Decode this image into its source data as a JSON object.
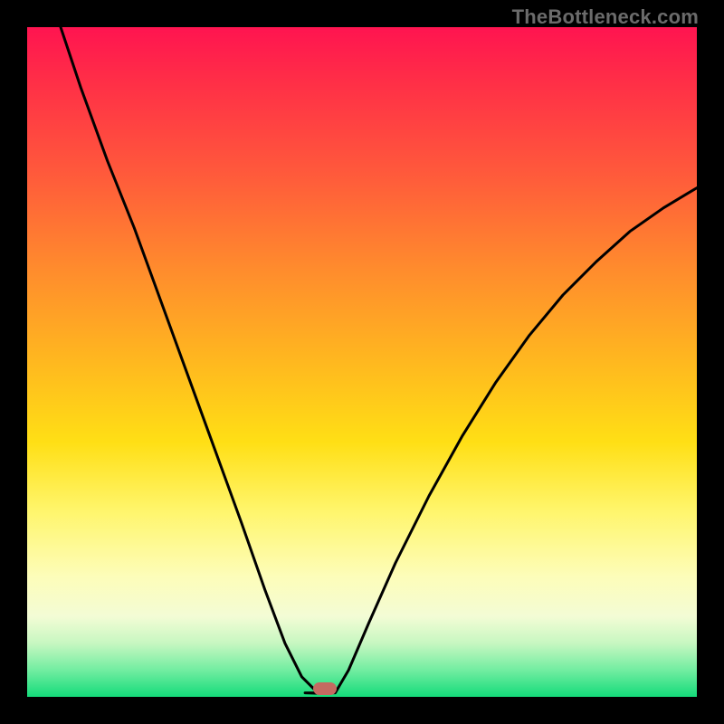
{
  "watermark": "TheBottleneck.com",
  "marker": {
    "cx_frac": 0.445,
    "cy_frac": 0.988
  },
  "colors": {
    "curve": "#000000",
    "marker": "#c46a61"
  },
  "chart_data": {
    "type": "line",
    "title": "",
    "xlabel": "",
    "ylabel": "",
    "xlim": [
      0,
      1
    ],
    "ylim": [
      0,
      1
    ],
    "annotations": [
      "TheBottleneck.com"
    ],
    "series": [
      {
        "name": "left-branch",
        "x": [
          0.05,
          0.08,
          0.12,
          0.16,
          0.2,
          0.24,
          0.28,
          0.32,
          0.355,
          0.385,
          0.41,
          0.43,
          0.44
        ],
        "y": [
          1.0,
          0.91,
          0.8,
          0.7,
          0.59,
          0.48,
          0.37,
          0.26,
          0.16,
          0.08,
          0.03,
          0.01,
          0.005
        ]
      },
      {
        "name": "valley-floor",
        "x": [
          0.415,
          0.46
        ],
        "y": [
          0.006,
          0.006
        ]
      },
      {
        "name": "right-branch",
        "x": [
          0.46,
          0.48,
          0.51,
          0.55,
          0.6,
          0.65,
          0.7,
          0.75,
          0.8,
          0.85,
          0.9,
          0.95,
          1.0
        ],
        "y": [
          0.006,
          0.04,
          0.11,
          0.2,
          0.3,
          0.39,
          0.47,
          0.54,
          0.6,
          0.65,
          0.695,
          0.73,
          0.76
        ]
      }
    ],
    "marker": {
      "x": 0.445,
      "y": 0.012,
      "shape": "rounded-rect"
    }
  }
}
